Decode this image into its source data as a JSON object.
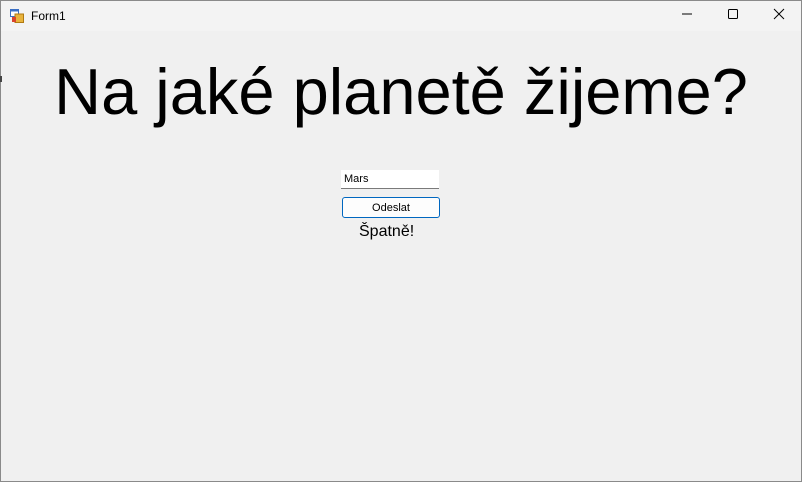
{
  "window": {
    "title": "Form1",
    "icon": "winforms-app-icon",
    "controls": {
      "minimize_icon": "minimize-icon",
      "maximize_icon": "maximize-icon",
      "close_icon": "close-icon"
    }
  },
  "form": {
    "question": "Na jaké planetě žijeme?",
    "answer_value": "Mars",
    "submit_label": "Odeslat",
    "result_text": "Špatně!"
  },
  "colors": {
    "background": "#f0f0f0",
    "button_border": "#0067c0"
  }
}
